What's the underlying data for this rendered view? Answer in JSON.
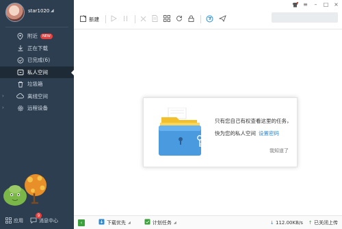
{
  "sidebar": {
    "username": "star1020",
    "items": [
      {
        "label": "附近",
        "badge": "NEW",
        "icon": "location-icon"
      },
      {
        "label": "正在下载",
        "icon": "download-icon"
      },
      {
        "label": "已完成(6)",
        "icon": "check-circle-icon"
      },
      {
        "label": "私人空间",
        "icon": "lock-icon",
        "active": true
      },
      {
        "label": "垃圾箱",
        "icon": "trash-icon"
      },
      {
        "label": "离线空间",
        "icon": "cloud-icon"
      },
      {
        "label": "远程设备",
        "icon": "gear-icon"
      }
    ],
    "bottom": {
      "apps_label": "应用",
      "messages_label": "消息中心",
      "messages_count": "9"
    }
  },
  "toolbar": {
    "new_label": "新建"
  },
  "dialog": {
    "line1": "只有您自己有权查看这里的任务，",
    "line2": "快为您的私人空间",
    "link": "设置密码",
    "ok": "我知道了"
  },
  "statusbar": {
    "download_priority": "下载优先",
    "scheduled_tasks": "计划任务",
    "speed": "112.00KB/s",
    "upload_status": "已关闭上传"
  },
  "colors": {
    "sidebar_bg": "#2d3e50",
    "active_bg": "#1e2a36",
    "accent": "#2a8ad4",
    "badge": "#e8403e",
    "status_green": "#3ca13c"
  }
}
